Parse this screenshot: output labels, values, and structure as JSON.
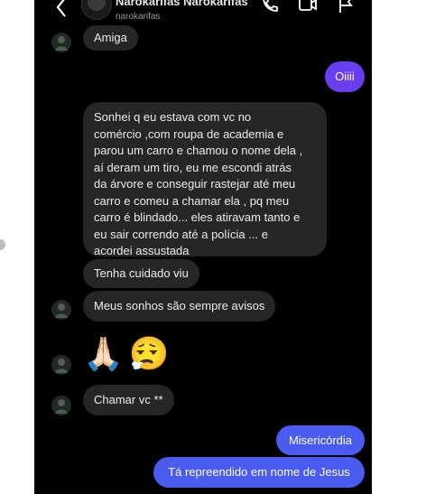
{
  "header": {
    "name": "Narokarifas Narokarifas",
    "handle": "narokarifas"
  },
  "messages": {
    "m1": "Amiga",
    "m2": "Oiiii",
    "m3_lines": [
      "Sonhei q eu estava  com vc no",
      "comércio ,com roupa de academia e",
      "parou um carro e chamou o nome dela ,",
      "aí deram um tiro, eu me escondi atrás",
      "da árvore e conseguir rastejar até meu",
      "carro e comeu a chamar ela , pq meu",
      "carro é blindado... eles atiravam tanto e",
      "eu sair correndo até a polícia ... e",
      "acordei assustada"
    ],
    "m4": "Tenha cuidado viu",
    "m5": "Meus sonhos são sempre avisos",
    "m6_emoji": [
      "🙏🏻",
      "😮‍💨"
    ],
    "m7": "Chamar vc **",
    "m8": "Misericórdia",
    "m9": "Tá repreendido em nome de Jesus"
  },
  "colors": {
    "background": "#000000",
    "incoming_bubble": "#262626",
    "outgoing_bubble": "#4a5bf0",
    "outgoing_bubble_purple": "#6a3df0"
  }
}
